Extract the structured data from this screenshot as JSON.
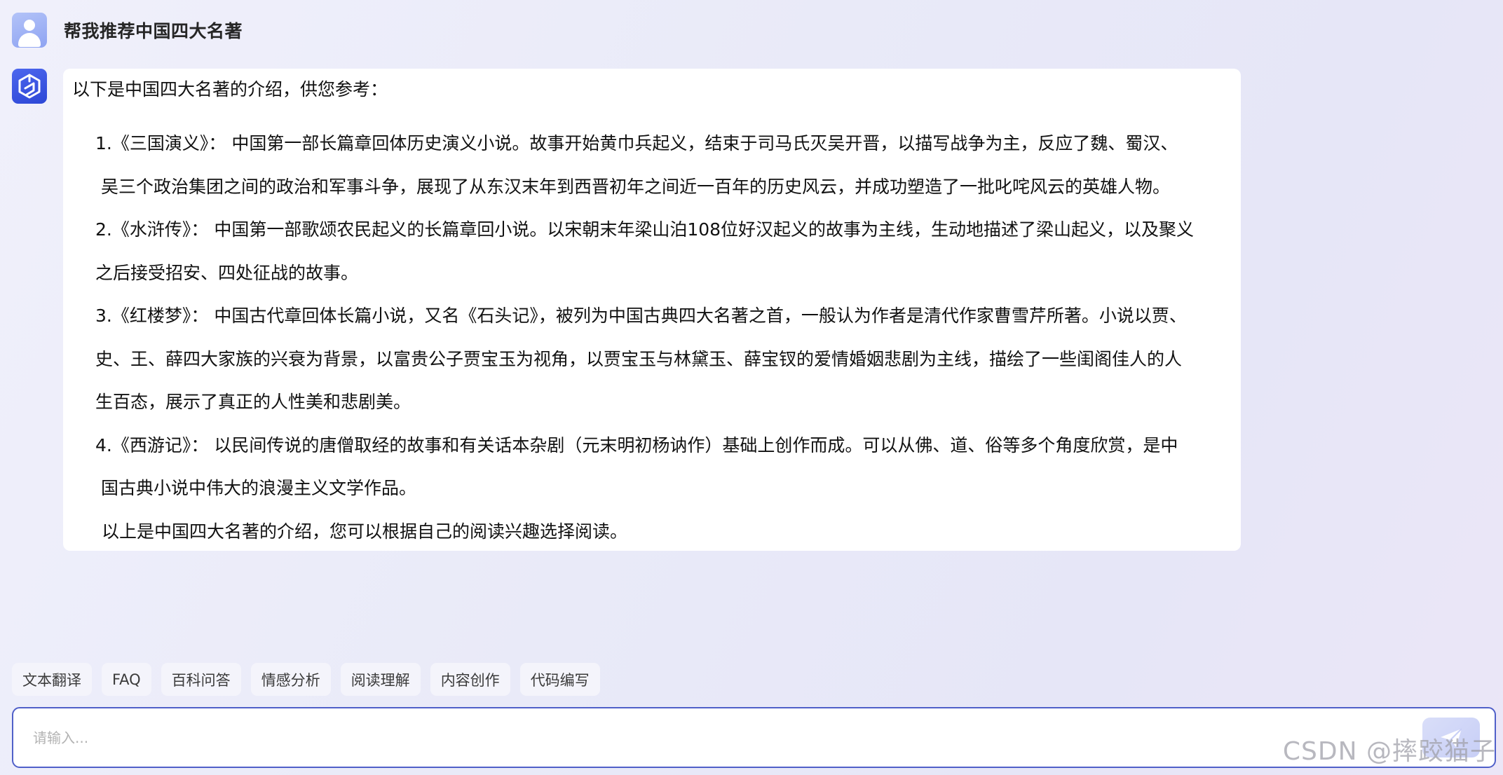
{
  "user_message": "帮我推荐中国四大名著",
  "bot_message": {
    "intro": "以下是中国四大名著的介绍，供您参考：",
    "items": [
      {
        "label": "1.《三国演义》：",
        "lines": [
          "中国第一部长篇章回体历史演义小说。故事开始黄巾兵起义，结束于司马氏灭吴开晋，以描写战争为主，反应了魏、蜀汉、",
          "吴三个政治集团之间的政治和军事斗争，展现了从东汉末年到西晋初年之间近一百年的历史风云，并成功塑造了一批叱咤风云的英雄人物。"
        ]
      },
      {
        "label": "2.《水浒传》：",
        "lines": [
          "中国第一部歌颂农民起义的长篇章回小说。以宋朝末年梁山泊108位好汉起义的故事为主线，生动地描述了梁山起义，以及聚义",
          "之后接受招安、四处征战的故事。"
        ]
      },
      {
        "label": "3.《红楼梦》：",
        "lines": [
          "中国古代章回体长篇小说，又名《石头记》，被列为中国古典四大名著之首，一般认为作者是清代作家曹雪芹所著。小说以贾、",
          "史、王、薛四大家族的兴衰为背景，以富贵公子贾宝玉为视角，以贾宝玉与林黛玉、薛宝钗的爱情婚姻悲剧为主线，描绘了一些闺阁佳人的人",
          "生百态，展示了真正的人性美和悲剧美。"
        ]
      },
      {
        "label": "4.《西游记》：",
        "lines": [
          "以民间传说的唐僧取经的故事和有关话本杂剧（元末明初杨讷作）基础上创作而成。可以从佛、道、俗等多个角度欣赏，是中",
          "国古典小说中伟大的浪漫主义文学作品。"
        ]
      }
    ],
    "outro": "以上是中国四大名著的介绍，您可以根据自己的阅读兴趣选择阅读。"
  },
  "quick_actions": [
    "文本翻译",
    "FAQ",
    "百科问答",
    "情感分析",
    "阅读理解",
    "内容创作",
    "代码编写"
  ],
  "input": {
    "placeholder": "请输入...",
    "value": ""
  },
  "icons": {
    "user_avatar": "user-icon",
    "bot_avatar": "hexagon-logo-icon",
    "send": "send-icon"
  },
  "watermark": "CSDN @摔跤猫子",
  "colors": {
    "accent": "#5060c9",
    "bot_avatar": "#3a55e0",
    "user_avatar": "#9fb1f5"
  }
}
